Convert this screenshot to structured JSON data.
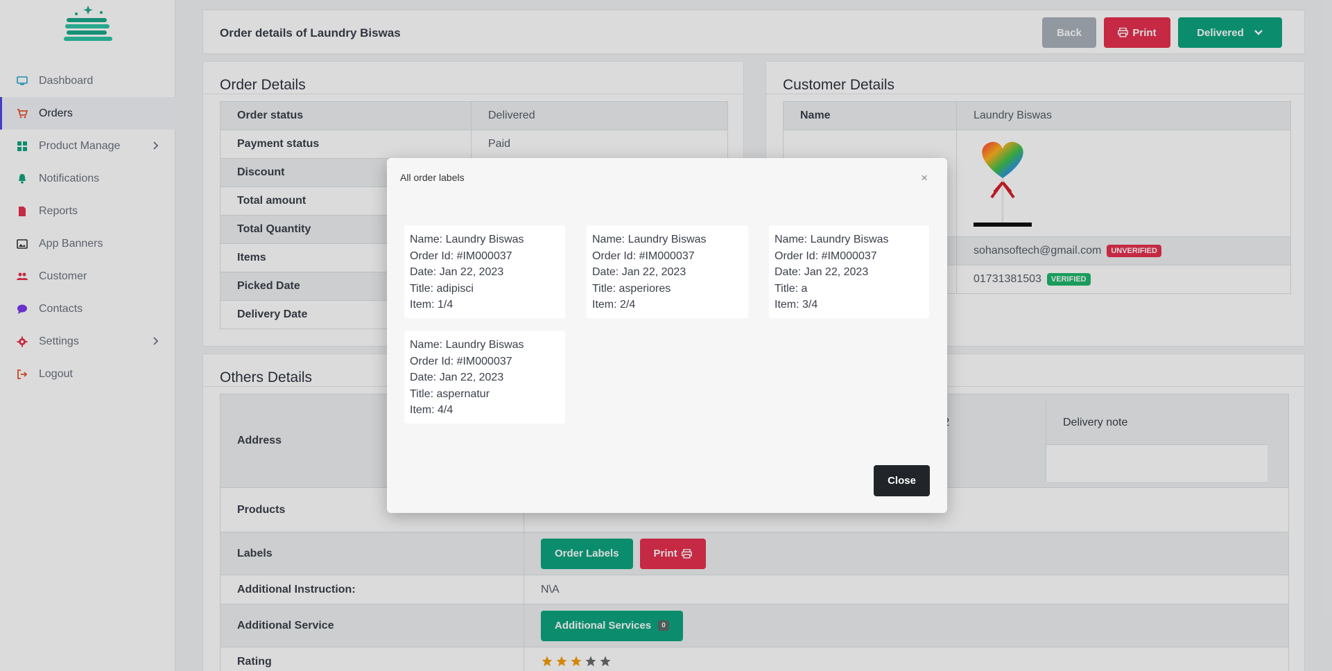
{
  "sidebar": {
    "items": [
      {
        "label": "Dashboard",
        "icon": "monitor-icon",
        "color": "#22a7c9"
      },
      {
        "label": "Orders",
        "icon": "cart-icon",
        "color": "#e8532c"
      },
      {
        "label": "Product Manage",
        "icon": "grid-icon",
        "color": "#14a37f"
      },
      {
        "label": "Notifications",
        "icon": "bell-icon",
        "color": "#14a37f"
      },
      {
        "label": "Reports",
        "icon": "file-icon",
        "color": "#e6304f"
      },
      {
        "label": "App Banners",
        "icon": "image-icon",
        "color": "#333333"
      },
      {
        "label": "Customer",
        "icon": "users-icon",
        "color": "#e6304f"
      },
      {
        "label": "Contacts",
        "icon": "chat-icon",
        "color": "#7c3aed"
      },
      {
        "label": "Settings",
        "icon": "gear-icon",
        "color": "#e6304f"
      },
      {
        "label": "Logout",
        "icon": "logout-icon",
        "color": "#e8532c"
      }
    ]
  },
  "header": {
    "title": "Order details of Laundry Biswas",
    "back_label": "Back",
    "print_label": "Print",
    "status_label": "Delivered"
  },
  "order_details": {
    "title": "Order Details",
    "rows": [
      {
        "key": "Order status",
        "value": "Delivered"
      },
      {
        "key": "Payment status",
        "value": "Paid"
      },
      {
        "key": "Discount",
        "value": ""
      },
      {
        "key": "Total amount",
        "value": ""
      },
      {
        "key": "Total Quantity",
        "value": ""
      },
      {
        "key": "Items",
        "value": ""
      },
      {
        "key": "Picked Date",
        "value": ""
      },
      {
        "key": "Delivery Date",
        "value": ""
      }
    ]
  },
  "customer_details": {
    "title": "Customer Details",
    "name_key": "Name",
    "name_value": "Laundry Biswas",
    "email": "sohansoftech@gmail.com",
    "email_badge": "UNVERIFIED",
    "phone": "01731381503",
    "phone_badge": "VERIFIED"
  },
  "others_details": {
    "title": "Others Details",
    "address_key": "Address",
    "col_partial": "e 2",
    "col_delivery_note": "Delivery note",
    "products_key": "Products",
    "labels_key": "Labels",
    "order_labels_btn": "Order Labels",
    "print_btn": "Print",
    "instruction_key": "Additional Instruction:",
    "instruction_value": "N\\A",
    "service_key": "Additional Service",
    "service_btn": "Additional Services",
    "service_count": "0",
    "rating_key": "Rating",
    "rating": 3,
    "rating_max": 5
  },
  "modal": {
    "title": "All order labels",
    "close_x": "×",
    "close_label": "Close",
    "labels": [
      {
        "name": "Name: Laundry Biswas",
        "order": "Order Id: #IM000037",
        "date": "Date: Jan 22, 2023",
        "title": "Title: adipisci",
        "item": "Item: 1/4"
      },
      {
        "name": "Name: Laundry Biswas",
        "order": "Order Id: #IM000037",
        "date": "Date: Jan 22, 2023",
        "title": "Title: asperiores",
        "item": "Item: 2/4"
      },
      {
        "name": "Name: Laundry Biswas",
        "order": "Order Id: #IM000037",
        "date": "Date: Jan 22, 2023",
        "title": "Title: a",
        "item": "Item: 3/4"
      },
      {
        "name": "Name: Laundry Biswas",
        "order": "Order Id: #IM000037",
        "date": "Date: Jan 22, 2023",
        "title": "Title: aspernatur",
        "item": "Item: 4/4"
      }
    ]
  }
}
